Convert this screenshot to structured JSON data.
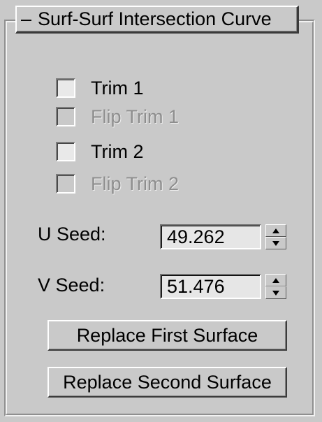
{
  "rollout": {
    "collapse_symbol": "–",
    "title": "Surf-Surf Intersection Curve"
  },
  "options": {
    "trim1": {
      "label": "Trim 1",
      "checked": false,
      "enabled": true
    },
    "flip_trim1": {
      "label": "Flip Trim 1",
      "checked": false,
      "enabled": false
    },
    "trim2": {
      "label": "Trim 2",
      "checked": false,
      "enabled": true
    },
    "flip_trim2": {
      "label": "Flip Trim 2",
      "checked": false,
      "enabled": false
    }
  },
  "seeds": {
    "u_label": "U Seed:",
    "u_value": "49.262",
    "v_label": "V Seed:",
    "v_value": "51.476"
  },
  "buttons": {
    "replace_first": "Replace First Surface",
    "replace_second": "Replace Second Surface"
  },
  "colors": {
    "panel_bg": "#c9c9c9",
    "disabled_text": "#8e8e8e"
  }
}
